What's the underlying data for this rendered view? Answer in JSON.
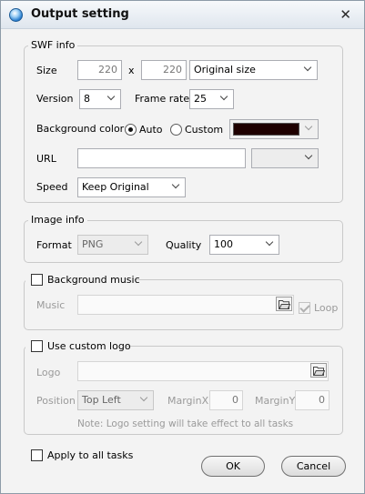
{
  "window": {
    "title": "Output setting"
  },
  "swf": {
    "legend": "SWF info",
    "size_label": "Size",
    "width": "220",
    "x_sep": "x",
    "height": "220",
    "size_preset": "Original size",
    "version_label": "Version",
    "version": "8",
    "frame_rate_label": "Frame rate",
    "frame_rate": "25",
    "bg_color_label": "Background color",
    "auto_label": "Auto",
    "custom_label": "Custom",
    "bg_color_hex": "#1e0000",
    "url_label": "URL",
    "url_value": "",
    "speed_label": "Speed",
    "speed": "Keep Original"
  },
  "image": {
    "legend": "Image info",
    "format_label": "Format",
    "format": "PNG",
    "quality_label": "Quality",
    "quality": "100"
  },
  "music": {
    "legend": "Background music",
    "music_label": "Music",
    "music_path": "",
    "loop_label": "Loop"
  },
  "logo": {
    "legend": "Use custom logo",
    "logo_label": "Logo",
    "logo_path": "",
    "position_label": "Position",
    "position": "Top Left",
    "marginx_label": "MarginX",
    "marginx": "0",
    "marginy_label": "MarginY",
    "marginy": "0",
    "note": "Note: Logo setting will take effect to all tasks"
  },
  "footer": {
    "apply_all_label": "Apply to all tasks",
    "ok_label": "OK",
    "cancel_label": "Cancel"
  }
}
